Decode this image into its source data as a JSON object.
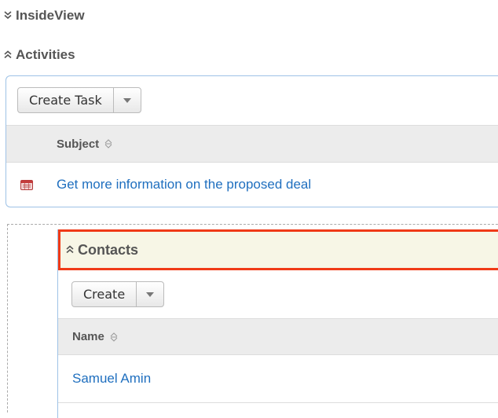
{
  "insideview": {
    "title": "InsideView",
    "icon": "double-chevron-down-icon"
  },
  "activities": {
    "title": "Activities",
    "icon": "double-chevron-up-icon",
    "create_button": "Create Task",
    "column_header": "Subject",
    "rows": [
      {
        "subject": "Get more information on the proposed deal",
        "icon": "calendar-icon"
      }
    ]
  },
  "contacts": {
    "title": "Contacts",
    "icon": "double-chevron-up-icon",
    "create_button": "Create",
    "column_header": "Name",
    "rows": [
      {
        "name": "Samuel Amin"
      }
    ]
  },
  "colors": {
    "link": "#1f6fbf",
    "highlight_border": "#f03a17",
    "panel_border": "#9ec2e6",
    "header_bg": "#ececec",
    "contacts_bg": "#f7f6e6"
  }
}
